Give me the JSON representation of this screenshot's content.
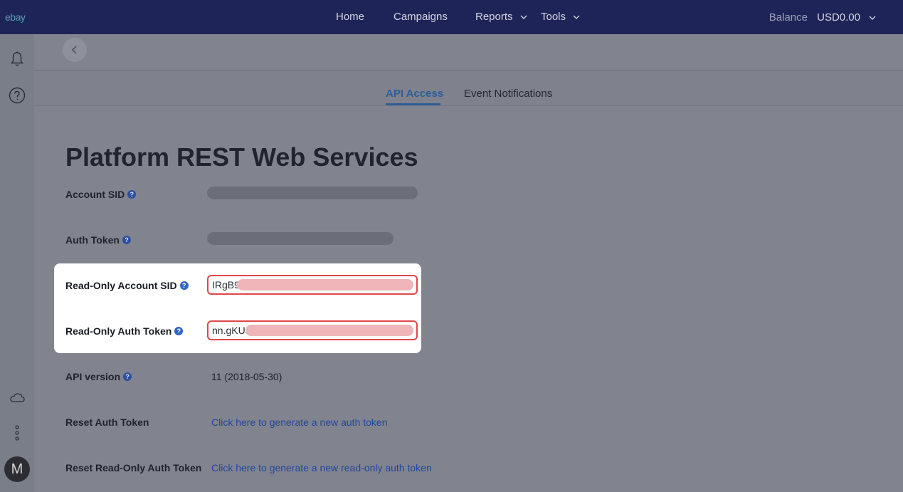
{
  "topbar": {
    "logo": "ebay",
    "nav": [
      "Home",
      "Campaigns",
      "Reports",
      "Tools"
    ],
    "balance_label": "Balance",
    "balance_value": "USD0.00"
  },
  "tabs": {
    "api_access": "API Access",
    "event_notifications": "Event Notifications"
  },
  "page": {
    "title": "Platform REST Web Services",
    "account_sid_label": "Account SID",
    "auth_token_label": "Auth Token",
    "ro_account_sid_label": "Read-Only Account SID",
    "ro_account_sid_value": "IRgB9",
    "ro_auth_token_label": "Read-Only Auth Token",
    "ro_auth_token_value": "nn.gKUs",
    "api_version_label": "API version",
    "api_version_value": "11 (2018-05-30)",
    "reset_auth_label": "Reset Auth Token",
    "reset_auth_link": "Click here to generate a new auth token",
    "reset_ro_label": "Reset Read-Only Auth Token",
    "reset_ro_link": "Click here to generate a new read-only auth token"
  },
  "avatar": "M",
  "help_glyph": "?"
}
